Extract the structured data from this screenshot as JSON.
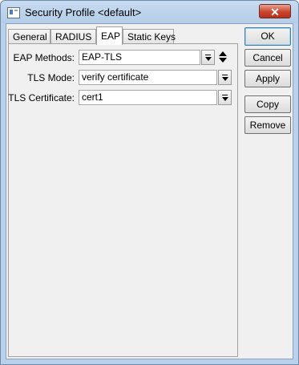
{
  "window": {
    "title": "Security Profile <default>",
    "close_glyph": "✕"
  },
  "tabs": [
    {
      "label": "General",
      "active": false
    },
    {
      "label": "RADIUS",
      "active": false
    },
    {
      "label": "EAP",
      "active": true
    },
    {
      "label": "Static Keys",
      "active": false
    }
  ],
  "form": {
    "eap_methods": {
      "label": "EAP Methods:",
      "value": "EAP-TLS"
    },
    "tls_mode": {
      "label": "TLS Mode:",
      "value": "verify certificate"
    },
    "tls_certificate": {
      "label": "TLS Certificate:",
      "value": "cert1"
    }
  },
  "buttons": {
    "ok": "OK",
    "cancel": "Cancel",
    "apply": "Apply",
    "copy": "Copy",
    "remove": "Remove"
  },
  "colors": {
    "titlebar": "#b9d1ea",
    "close_button": "#c9452f",
    "panel_background": "#f0f0f0"
  }
}
